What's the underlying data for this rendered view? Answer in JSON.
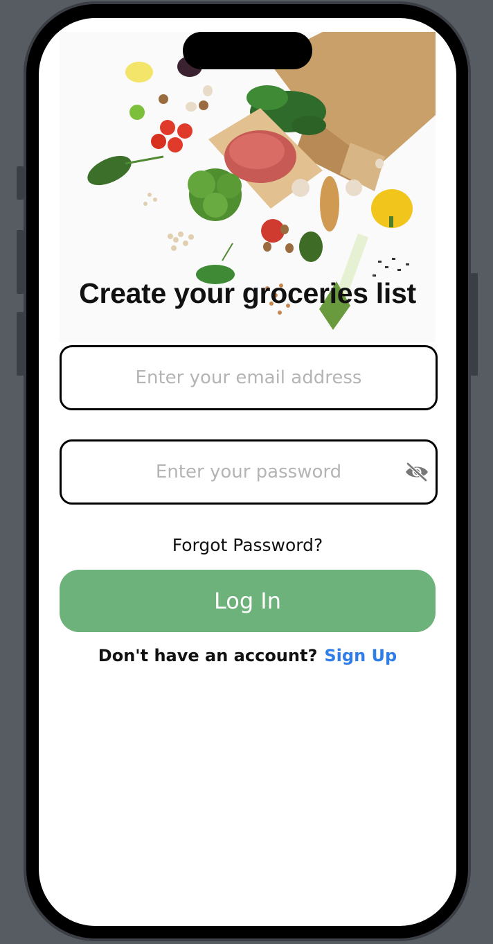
{
  "header": {
    "title": "Create your groceries list",
    "hero_image": "groceries-flatlay-illustration"
  },
  "form": {
    "email_placeholder": "Enter your email address",
    "email_value": "",
    "password_placeholder": "Enter your password",
    "password_value": "",
    "password_toggle_icon": "eye-slash-icon"
  },
  "actions": {
    "forgot_password": "Forgot Password?",
    "login_label": "Log In",
    "signup_prompt": "Don't have an account?",
    "signup_link": "Sign Up"
  },
  "colors": {
    "primary": "#6db27b",
    "link": "#2f7de9",
    "text": "#111111",
    "placeholder": "#b4b4b4"
  }
}
